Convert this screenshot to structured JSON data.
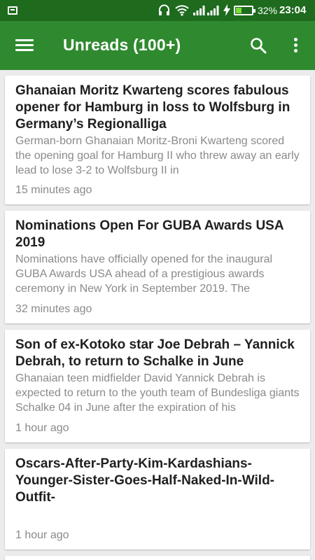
{
  "status_bar": {
    "battery_percent": "32%",
    "battery_level": 0.32,
    "time": "23:04",
    "icons": [
      "sim-icon",
      "headset-icon",
      "wifi-icon",
      "signal-icon",
      "signal-icon",
      "charging-bolt-icon",
      "battery-icon"
    ]
  },
  "app_bar": {
    "title": "Unreads (100+)",
    "icons": [
      "menu-icon",
      "search-icon",
      "more-icon"
    ]
  },
  "colors": {
    "status_bar": "#1e6b1e",
    "app_bar": "#2f8a2f",
    "background": "#ececec",
    "card": "#ffffff",
    "title_text": "#202020",
    "secondary_text": "#8a8a8a"
  },
  "articles": [
    {
      "title": "Ghanaian Moritz Kwarteng scores fabulous opener for Hamburg in loss to Wolfsburg in Germany’s Regionalliga",
      "excerpt": "German-born Ghanaian Moritz-Broni Kwarteng scored the opening goal for Hamburg II who threw away an early lead to lose 3-2 to Wolfsburg II in",
      "time": "15 minutes ago"
    },
    {
      "title": "Nominations Open For GUBA Awards USA 2019",
      "excerpt": "Nominations have officially opened for the inaugural GUBA Awards USA ahead of a prestigious awards ceremony in New York in September 2019. The",
      "time": "32 minutes ago"
    },
    {
      "title": "Son of ex-Kotoko star Joe Debrah – Yannick Debrah, to return to Schalke in June",
      "excerpt": "Ghanaian teen midfielder David Yannick Debrah is expected to return to the youth team of Bundesliga giants Schalke 04 in June after the expiration of his",
      "time": "1 hour ago"
    },
    {
      "title": "Oscars-After-Party-Kim-Kardashians-Younger-Sister-Goes-Half-Naked-In-Wild-Outfit-",
      "excerpt": "",
      "time": "1 hour ago"
    }
  ]
}
